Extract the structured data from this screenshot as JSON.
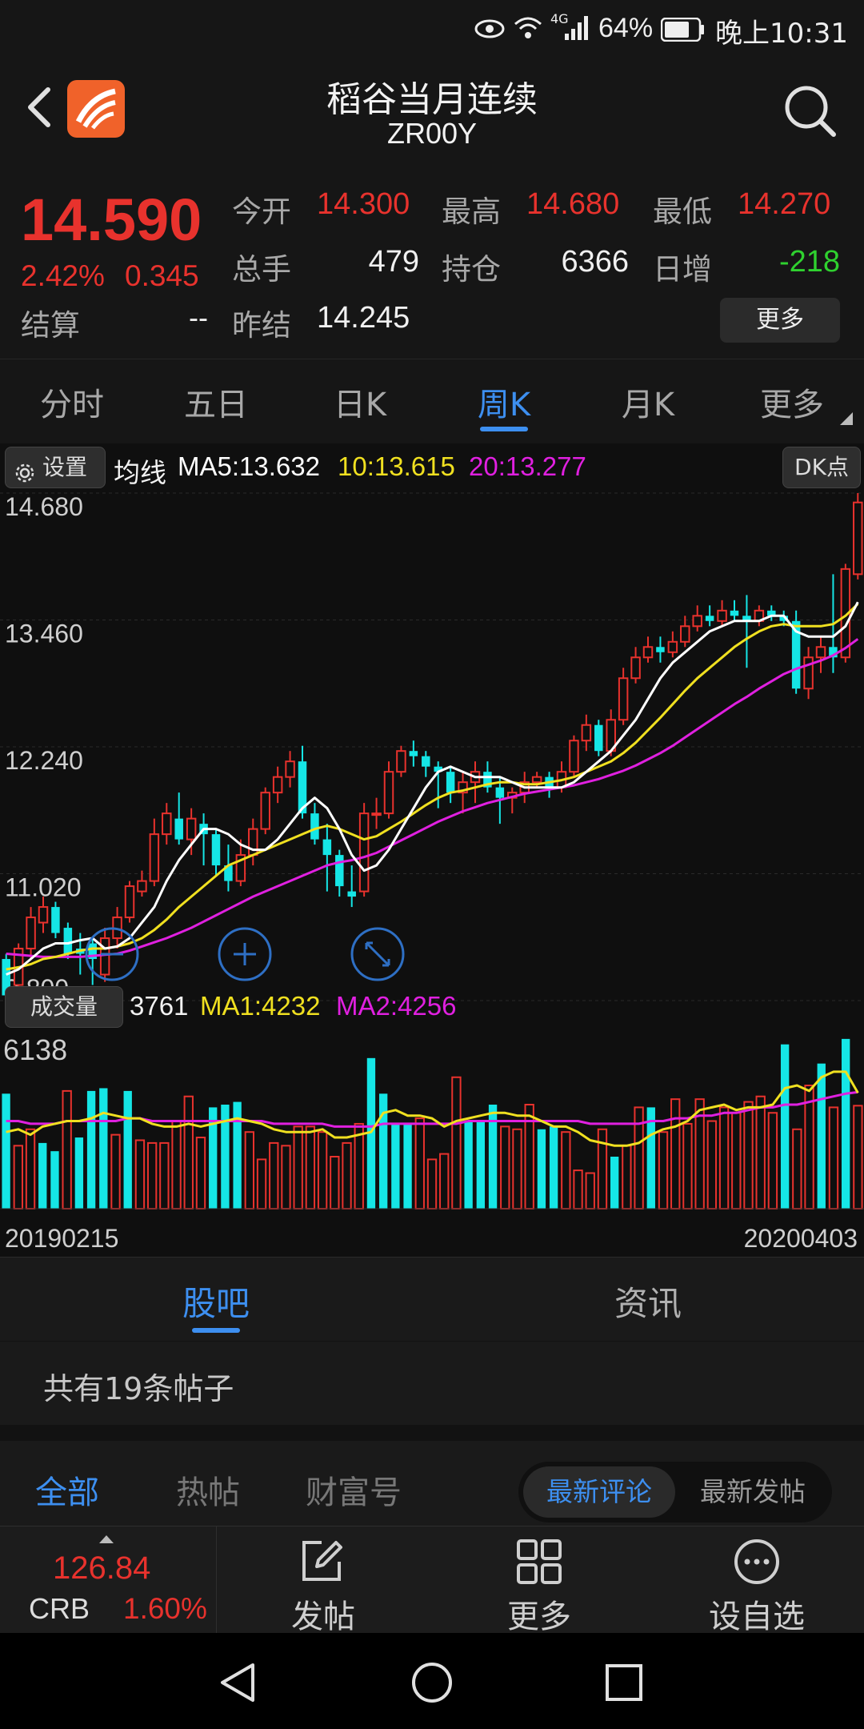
{
  "status_bar": {
    "network": "4G",
    "battery": "64%",
    "time": "晚上10:31"
  },
  "header": {
    "title": "稻谷当月连续",
    "code": "ZR00Y"
  },
  "quote": {
    "price": "14.590",
    "change_pct": "2.42%",
    "change": "0.345",
    "settle_label": "结算",
    "settle_value": "--",
    "open_label": "今开",
    "open_value": "14.300",
    "high_label": "最高",
    "high_value": "14.680",
    "low_label": "最低",
    "low_value": "14.270",
    "volume_label": "总手",
    "volume_value": "479",
    "position_label": "持仓",
    "position_value": "6366",
    "daily_add_label": "日增",
    "daily_add_value": "-218",
    "prev_settle_label": "昨结",
    "prev_settle_value": "14.245",
    "more_button": "更多"
  },
  "period_tabs": [
    {
      "label": "分时",
      "active": false
    },
    {
      "label": "五日",
      "active": false
    },
    {
      "label": "日K",
      "active": false
    },
    {
      "label": "周K",
      "active": true
    },
    {
      "label": "月K",
      "active": false
    },
    {
      "label": "更多",
      "active": false
    }
  ],
  "chart_toolbar": {
    "settings": "设置",
    "ma_label": "均线",
    "ma5": "MA5:13.632",
    "ma10": "10:13.615",
    "ma20": "20:13.277",
    "dk_button": "DK点"
  },
  "volume_toolbar": {
    "label": "成交量",
    "current": "3761",
    "ma1": "MA1:4232",
    "ma2": "MA2:4256"
  },
  "colors": {
    "up": "#e8322d",
    "down": "#15e6e6",
    "ma5": "#ffffff",
    "ma10": "#f0e020",
    "ma20": "#e020e0",
    "accent": "#3d8ff0"
  },
  "chart_data": {
    "type": "candlestick",
    "period": "weekly",
    "ylim": [
      9.8,
      14.68
    ],
    "y_ticks": [
      "14.680",
      "13.460",
      "12.240",
      "11.020",
      "9.800"
    ],
    "x_start": "20190215",
    "x_end": "20200403",
    "candles": [
      [
        10.2,
        9.85,
        10.25,
        9.8
      ],
      [
        9.95,
        10.3,
        10.35,
        9.9
      ],
      [
        10.3,
        10.6,
        10.7,
        10.2
      ],
      [
        10.55,
        10.7,
        10.8,
        10.45
      ],
      [
        10.7,
        10.45,
        10.75,
        10.4
      ],
      [
        10.5,
        10.25,
        10.55,
        10.2
      ],
      [
        10.3,
        10.25,
        10.45,
        10.05
      ],
      [
        10.35,
        10.2,
        10.4,
        9.95
      ],
      [
        10.05,
        10.4,
        10.5,
        9.98
      ],
      [
        10.4,
        10.6,
        10.7,
        10.3
      ],
      [
        10.6,
        10.9,
        10.95,
        10.55
      ],
      [
        10.85,
        10.95,
        11.05,
        10.8
      ],
      [
        10.95,
        11.4,
        11.55,
        10.9
      ],
      [
        11.4,
        11.6,
        11.7,
        11.3
      ],
      [
        11.55,
        11.35,
        11.8,
        11.3
      ],
      [
        11.35,
        11.55,
        11.65,
        11.2
      ],
      [
        11.5,
        11.4,
        11.6,
        11.1
      ],
      [
        11.4,
        11.1,
        11.45,
        11.0
      ],
      [
        11.1,
        10.95,
        11.3,
        10.85
      ],
      [
        10.95,
        11.2,
        11.35,
        10.9
      ],
      [
        11.2,
        11.45,
        11.55,
        11.1
      ],
      [
        11.45,
        11.8,
        11.85,
        11.4
      ],
      [
        11.8,
        11.95,
        12.05,
        11.7
      ],
      [
        11.95,
        12.1,
        12.2,
        11.85
      ],
      [
        12.1,
        11.6,
        12.25,
        11.55
      ],
      [
        11.6,
        11.35,
        11.7,
        11.3
      ],
      [
        11.35,
        11.2,
        11.5,
        10.85
      ],
      [
        11.2,
        10.9,
        11.25,
        10.8
      ],
      [
        10.85,
        10.8,
        11.1,
        10.7
      ],
      [
        10.85,
        11.6,
        11.7,
        10.8
      ],
      [
        11.6,
        11.6,
        11.75,
        11.45
      ],
      [
        11.6,
        12.0,
        12.1,
        11.55
      ],
      [
        12.0,
        12.2,
        12.25,
        11.95
      ],
      [
        12.2,
        12.15,
        12.3,
        12.05
      ],
      [
        12.15,
        12.05,
        12.2,
        11.95
      ],
      [
        12.05,
        12.0,
        12.1,
        11.65
      ],
      [
        12.0,
        11.8,
        12.05,
        11.7
      ],
      [
        11.8,
        11.9,
        12.0,
        11.6
      ],
      [
        11.9,
        12.0,
        12.1,
        11.7
      ],
      [
        12.0,
        11.85,
        12.1,
        11.8
      ],
      [
        11.85,
        11.75,
        11.95,
        11.5
      ],
      [
        11.75,
        11.8,
        11.85,
        11.6
      ],
      [
        11.8,
        11.9,
        12.0,
        11.7
      ],
      [
        11.9,
        11.95,
        12.0,
        11.85
      ],
      [
        11.95,
        11.85,
        12.0,
        11.75
      ],
      [
        11.85,
        12.0,
        12.1,
        11.8
      ],
      [
        12.0,
        12.3,
        12.35,
        11.95
      ],
      [
        12.3,
        12.45,
        12.55,
        12.2
      ],
      [
        12.45,
        12.2,
        12.5,
        12.15
      ],
      [
        12.2,
        12.5,
        12.6,
        12.15
      ],
      [
        12.5,
        12.9,
        13.0,
        12.45
      ],
      [
        12.9,
        13.1,
        13.2,
        12.85
      ],
      [
        13.1,
        13.2,
        13.3,
        13.05
      ],
      [
        13.2,
        13.15,
        13.3,
        13.05
      ],
      [
        13.15,
        13.25,
        13.35,
        13.1
      ],
      [
        13.25,
        13.4,
        13.5,
        13.2
      ],
      [
        13.4,
        13.5,
        13.6,
        13.35
      ],
      [
        13.5,
        13.45,
        13.6,
        13.4
      ],
      [
        13.45,
        13.55,
        13.65,
        13.4
      ],
      [
        13.55,
        13.5,
        13.65,
        13.45
      ],
      [
        13.5,
        13.45,
        13.7,
        13.0
      ],
      [
        13.45,
        13.55,
        13.6,
        13.4
      ],
      [
        13.55,
        13.5,
        13.6,
        13.45
      ],
      [
        13.5,
        13.45,
        13.55,
        13.4
      ],
      [
        13.45,
        12.8,
        13.55,
        12.75
      ],
      [
        12.8,
        13.1,
        13.2,
        12.7
      ],
      [
        13.1,
        13.2,
        13.3,
        12.95
      ],
      [
        13.2,
        13.1,
        13.9,
        12.95
      ],
      [
        13.1,
        13.95,
        14.0,
        13.05
      ],
      [
        13.9,
        14.59,
        14.68,
        13.85
      ]
    ],
    "ma5": [
      10.05,
      10.1,
      10.2,
      10.3,
      10.35,
      10.35,
      10.38,
      10.4,
      10.3,
      10.32,
      10.4,
      10.55,
      10.7,
      10.95,
      11.15,
      11.3,
      11.45,
      11.45,
      11.4,
      11.3,
      11.25,
      11.25,
      11.35,
      11.5,
      11.65,
      11.75,
      11.65,
      11.45,
      11.2,
      11.05,
      11.1,
      11.25,
      11.45,
      11.65,
      11.85,
      12.0,
      12.05,
      12.0,
      11.95,
      11.95,
      11.95,
      11.9,
      11.85,
      11.85,
      11.85,
      11.85,
      11.9,
      12.0,
      12.1,
      12.2,
      12.35,
      12.5,
      12.7,
      12.9,
      13.05,
      13.15,
      13.25,
      13.35,
      13.4,
      13.45,
      13.45,
      13.45,
      13.5,
      13.5,
      13.35,
      13.3,
      13.3,
      13.3,
      13.4,
      13.632
    ],
    "ma10": [
      10.1,
      10.12,
      10.15,
      10.2,
      10.22,
      10.25,
      10.28,
      10.3,
      10.3,
      10.32,
      10.35,
      10.4,
      10.48,
      10.58,
      10.7,
      10.8,
      10.9,
      11.0,
      11.1,
      11.15,
      11.2,
      11.25,
      11.3,
      11.35,
      11.4,
      11.45,
      11.48,
      11.45,
      11.4,
      11.35,
      11.38,
      11.45,
      11.52,
      11.6,
      11.68,
      11.75,
      11.8,
      11.82,
      11.85,
      11.88,
      11.9,
      11.9,
      11.88,
      11.88,
      11.9,
      11.92,
      11.95,
      12.0,
      12.05,
      12.1,
      12.18,
      12.28,
      12.4,
      12.52,
      12.65,
      12.78,
      12.9,
      13.0,
      13.1,
      13.2,
      13.28,
      13.35,
      13.4,
      13.42,
      13.4,
      13.4,
      13.4,
      13.42,
      13.5,
      13.615
    ],
    "ma20": [
      10.25,
      10.24,
      10.23,
      10.22,
      10.22,
      10.22,
      10.22,
      10.23,
      10.24,
      10.25,
      10.28,
      10.32,
      10.36,
      10.4,
      10.45,
      10.5,
      10.56,
      10.62,
      10.68,
      10.74,
      10.8,
      10.85,
      10.9,
      10.95,
      11.0,
      11.05,
      11.1,
      11.13,
      11.15,
      11.18,
      11.22,
      11.28,
      11.34,
      11.4,
      11.46,
      11.52,
      11.57,
      11.62,
      11.66,
      11.7,
      11.73,
      11.76,
      11.79,
      11.81,
      11.83,
      11.85,
      11.87,
      11.9,
      11.93,
      11.97,
      12.01,
      12.06,
      12.12,
      12.18,
      12.25,
      12.33,
      12.41,
      12.49,
      12.57,
      12.65,
      12.72,
      12.8,
      12.87,
      12.94,
      12.99,
      13.03,
      13.07,
      13.12,
      13.19,
      13.277
    ],
    "volume": {
      "ymax": 6138,
      "values": [
        4200,
        2300,
        2900,
        2400,
        2100,
        4300,
        2600,
        4300,
        4400,
        2700,
        4300,
        2500,
        2400,
        2400,
        3200,
        4100,
        2600,
        3700,
        3800,
        3900,
        2800,
        1800,
        2400,
        2300,
        3000,
        3000,
        2800,
        1900,
        2400,
        3100,
        5500,
        4200,
        3100,
        3100,
        3300,
        1800,
        2000,
        4800,
        3200,
        3200,
        3800,
        3000,
        2900,
        3800,
        2900,
        3000,
        2800,
        1400,
        1300,
        2900,
        1900,
        2300,
        3700,
        3700,
        2800,
        4000,
        3100,
        4000,
        3200,
        3700,
        3500,
        3900,
        4100,
        3500,
        6000,
        2900,
        4500,
        5300,
        3700,
        6200,
        3761
      ],
      "up": [
        false,
        true,
        true,
        false,
        false,
        true,
        false,
        false,
        false,
        true,
        false,
        true,
        true,
        true,
        true,
        true,
        true,
        false,
        false,
        false,
        true,
        true,
        true,
        true,
        true,
        true,
        true,
        true,
        true,
        true,
        false,
        false,
        false,
        false,
        true,
        true,
        true,
        true,
        false,
        false,
        false,
        true,
        true,
        true,
        false,
        false,
        true,
        true,
        true,
        true,
        false,
        true,
        true,
        false,
        true,
        true,
        true,
        true,
        true,
        true,
        true,
        true,
        true,
        true,
        false,
        true,
        true,
        false,
        true,
        false,
        true
      ],
      "ma1": [
        2800,
        2900,
        2700,
        3000,
        3100,
        3200,
        3200,
        3300,
        3500,
        3400,
        3300,
        3300,
        3100,
        3000,
        3000,
        3100,
        3000,
        3100,
        3200,
        3300,
        3200,
        3100,
        2900,
        2800,
        2800,
        2800,
        2900,
        2600,
        2600,
        2700,
        2800,
        3500,
        3600,
        3400,
        3400,
        3300,
        3000,
        3200,
        3300,
        3400,
        3500,
        3500,
        3400,
        3400,
        3200,
        3000,
        3000,
        2800,
        2500,
        2400,
        2300,
        2300,
        2400,
        2700,
        2900,
        3000,
        3200,
        3600,
        3700,
        3800,
        3600,
        3700,
        3700,
        3800,
        4400,
        4500,
        4300,
        4800,
        5000,
        5000,
        4232
      ],
      "ma2": [
        3200,
        3200,
        3100,
        3100,
        3100,
        3200,
        3200,
        3200,
        3200,
        3200,
        3300,
        3300,
        3200,
        3200,
        3200,
        3200,
        3200,
        3200,
        3200,
        3200,
        3200,
        3200,
        3100,
        3100,
        3100,
        3100,
        3100,
        3000,
        3000,
        3000,
        3000,
        3100,
        3100,
        3100,
        3100,
        3100,
        3100,
        3100,
        3200,
        3200,
        3200,
        3200,
        3200,
        3200,
        3200,
        3200,
        3200,
        3200,
        3100,
        3100,
        3100,
        3100,
        3100,
        3200,
        3200,
        3300,
        3300,
        3400,
        3400,
        3500,
        3500,
        3600,
        3700,
        3700,
        3800,
        3800,
        3900,
        4000,
        4100,
        4200,
        4256
      ]
    }
  },
  "content_tabs": [
    {
      "label": "股吧",
      "active": true
    },
    {
      "label": "资讯",
      "active": false
    }
  ],
  "posts_count": "共有19条帖子",
  "filter_tabs": [
    {
      "label": "全部",
      "active": true
    },
    {
      "label": "热帖",
      "active": false
    },
    {
      "label": "财富号",
      "active": false
    }
  ],
  "sort_toggle": [
    {
      "label": "最新评论",
      "active": true
    },
    {
      "label": "最新发帖",
      "active": false
    }
  ],
  "bottom_bar": {
    "index_value": "126.84",
    "index_name": "CRB",
    "index_change": "1.60%",
    "post": "发帖",
    "more": "更多",
    "watchlist": "设自选"
  }
}
